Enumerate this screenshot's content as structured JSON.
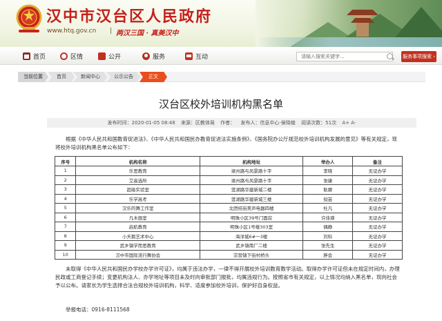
{
  "header": {
    "site_name": "汉中市汉台区人民政府",
    "url": "www.htq.gov.cn",
    "url_sep": "|",
    "slogan": "两汉三国 · 真美汉中"
  },
  "nav": {
    "items": [
      {
        "label": "首页",
        "icon": "home-icon"
      },
      {
        "label": "区情",
        "icon": "location-icon"
      },
      {
        "label": "公开",
        "icon": "document-icon"
      },
      {
        "label": "服务",
        "icon": "service-icon"
      },
      {
        "label": "互动",
        "icon": "chat-icon"
      }
    ],
    "search_placeholder": "请输入搜索关键字...",
    "service_button": "服务事项搜索"
  },
  "breadcrumb": {
    "label": "当前位置",
    "items": [
      "首页",
      "新闻中心",
      "公示公告",
      "正文"
    ]
  },
  "article": {
    "title": "汉台区校外培训机构黑名单",
    "meta": {
      "publish_time": "发布时间：2020-01-05 08:48",
      "source": "来源：区教体局",
      "author": "作者：",
      "publisher": "发布人：信息中心-侯晓棱",
      "views": "阅读次数：51次",
      "font_controls": "A+ A-"
    },
    "intro": "根据《中华人民共和国教育促进法》、《中华人民共和国民办教育促进法实施条例》、《国务院办公厅规范校外培训机构发展的意见》等有关规定，现将校外培训机构黑名单公布如下：",
    "table": {
      "headers": [
        "序号",
        "机构名称",
        "机构地址",
        "举办人",
        "备注"
      ],
      "rows": [
        [
          "1",
          "乐思教育",
          "梁州路与风景路十字",
          "李晓",
          "无证办学"
        ],
        [
          "2",
          "艾高选所",
          "梁州路与风景路十字",
          "张康",
          "无证办学"
        ],
        [
          "3",
          "超级实验室",
          "莲湖路华建新城二楼",
          "耿娜",
          "无证办学"
        ],
        [
          "4",
          "乐学高考",
          "莲湖路华建新城三楼",
          "倪芸",
          "无证办学"
        ],
        [
          "5",
          "汉乐的舞工作室",
          "北团结街美声电器四楼",
          "杜凡",
          "无证办学"
        ],
        [
          "6",
          "凡木画室",
          "明珠小区39号门面房",
          "许佳瑛",
          "无证办学"
        ],
        [
          "7",
          "启航教育",
          "明珠小区1号楼303室",
          "偶静",
          "无证办学"
        ],
        [
          "8",
          "小天鹅艺术中心",
          "海洋城6#一3楼",
          "刘科",
          "无证办学"
        ],
        [
          "9",
          "武乡镇学而思教育",
          "武乡镇南厂二楼",
          "张先生",
          "无证办学"
        ],
        [
          "10",
          "汉中市国际流行舞协会",
          "宗营镇下街村桥头",
          "胖会",
          "无证办学"
        ]
      ]
    },
    "notice": "未取得《中华人民共和国民办学校办学许可证》，均属于违法办学，一律不得开展校外培训教育教学活动。取得办学许可证但未在规定时间内，办理民政或工商登记手续；变更机构法人、办学地址等项目未及时向审批部门报批，均属违规行为。按照省市有关规定，以上情况均纳入黑名单，现向社会予以公布。请家长为学生选择合法合规校外培训机构，科学、适度参加校外培训，保护好自身权益。",
    "phone": "举报电话：0916-8111568"
  },
  "colors": {
    "brand_red": "#c4201b",
    "breadcrumb_current": "#e94f1c",
    "service_button": "#c2301f"
  }
}
